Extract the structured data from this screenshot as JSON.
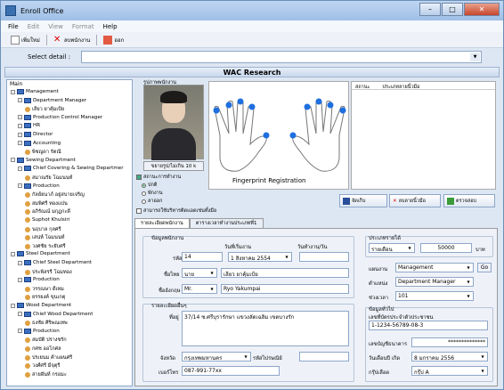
{
  "app": {
    "title": "Enroll Office"
  },
  "menu": [
    "File",
    "Edit",
    "View",
    "Format",
    "Help"
  ],
  "toolbar": {
    "new": "เพิ่มใหม่",
    "delete": "ลบพนักงาน",
    "exit": "ออก"
  },
  "select": {
    "label": "Select detail :",
    "value": ""
  },
  "header": {
    "title": "WAC Research"
  },
  "tree": {
    "title": "Main",
    "items": [
      {
        "label": "Management",
        "level": 1,
        "type": "folder"
      },
      {
        "label": "Department Manager",
        "level": 2,
        "type": "folder"
      },
      {
        "label": "เลียว ยาคุ้มเป้ย",
        "level": 3,
        "type": "person"
      },
      {
        "label": "Production Control Manager",
        "level": 2,
        "type": "folder"
      },
      {
        "label": "HR",
        "level": 2,
        "type": "folder"
      },
      {
        "label": "Director",
        "level": 2,
        "type": "folder"
      },
      {
        "label": "Accounting",
        "level": 2,
        "type": "folder"
      },
      {
        "label": "พิชญดา รัตณี",
        "level": 3,
        "type": "person"
      },
      {
        "label": "Sewing Department",
        "level": 1,
        "type": "folder"
      },
      {
        "label": "Chief Covering & Sewing Departmer",
        "level": 2,
        "type": "folder"
      },
      {
        "label": "สมาณรัย โฉมนนท์",
        "level": 3,
        "type": "person"
      },
      {
        "label": "Production",
        "level": 2,
        "type": "folder"
      },
      {
        "label": "กัลย์ยนาภ์ อยู่สบายเจริญ",
        "level": 3,
        "type": "person"
      },
      {
        "label": "สมพิศรี ทองแปน",
        "level": 3,
        "type": "person"
      },
      {
        "label": "อภิรัณณ์ มกุฏกะดี",
        "level": 3,
        "type": "person"
      },
      {
        "label": "Suphot Khulsiri",
        "level": 3,
        "type": "person"
      },
      {
        "label": "นฤบาล กุลศรี",
        "level": 3,
        "type": "person"
      },
      {
        "label": "เสน่ห์ โฉมนนท์",
        "level": 3,
        "type": "person"
      },
      {
        "label": "วงศชัย ระยับศรี",
        "level": 3,
        "type": "person"
      },
      {
        "label": "Steel Department",
        "level": 1,
        "type": "folder"
      },
      {
        "label": "Chief Steel Department",
        "level": 2,
        "type": "folder"
      },
      {
        "label": "ประพิสรรี โฉมทอง",
        "level": 3,
        "type": "person"
      },
      {
        "label": "Production",
        "level": 2,
        "type": "folder"
      },
      {
        "label": "วรรณษา ดีเหม",
        "level": 3,
        "type": "person"
      },
      {
        "label": "ยรรยงค์ ขุนเกตุ",
        "level": 3,
        "type": "person"
      },
      {
        "label": "Wood Department",
        "level": 1,
        "type": "folder"
      },
      {
        "label": "Chief Wood Department",
        "level": 2,
        "type": "folder"
      },
      {
        "label": "ธงชัย ศิริพณเทพ",
        "level": 3,
        "type": "person"
      },
      {
        "label": "Production",
        "level": 2,
        "type": "folder"
      },
      {
        "label": "สมบัติ ปรางชรัก",
        "level": 3,
        "type": "person"
      },
      {
        "label": "กศช ออโกศล",
        "level": 3,
        "type": "person"
      },
      {
        "label": "ปรเยนม ค้าแผนศรี",
        "level": 3,
        "type": "person"
      },
      {
        "label": "วงศ์ศรี มีจุตุรี",
        "level": 3,
        "type": "person"
      },
      {
        "label": "สายฝันท์ กรอมะ",
        "level": 3,
        "type": "person"
      }
    ]
  },
  "photo": {
    "label": "รูปภาพพนักงาน",
    "button": "ขยายรูป/ไม่เกิน 10 k"
  },
  "status": {
    "title": "สถานะการทำงาน",
    "options": [
      "ปกติ",
      "พักงาน",
      "ลาออก"
    ],
    "selected": 0,
    "all_work": "สามารถใช้บริหารติดแอดเช่นทั้งมือ"
  },
  "fingerprint": {
    "label": "Fingerprint Registration",
    "col1": "สถานะ",
    "col2": "ประเภทลายนิ้วมือ"
  },
  "actions": {
    "save": "จัดเก็บ",
    "delete_fp": "ลบลายนิ้วมือ",
    "verify": "ตรวจสอบ"
  },
  "tabs": [
    "รายละเอียดพนักงาน",
    "ตารางเวลาทำงานประเภทที่1"
  ],
  "form": {
    "section_employee": "ข้อมูลพนักงาน",
    "id_label": "รหัส",
    "id_value": "14",
    "start_label": "วันที่เริ่มงาน",
    "start_day": "1",
    "start_month": "สิงหาคม",
    "start_year": "2554",
    "workdays_label": "วันทำงาน/วัน",
    "thai_name_label": "ชื่อไทย",
    "thai_prefix": "นาย",
    "thai_name": "เลียว ยาคุ้มเป้ย",
    "en_name_label": "ชื่ออังกฤษ",
    "en_prefix": "Mr.",
    "en_name": "Ryo Yakumpai",
    "section_address": "รายละเอียดอื่นๆ",
    "address_label": "ที่อยู่",
    "address": "37/14 ซ.ศรีบุรารักษา แขวงลัดเฉลิม เขตบางรัก",
    "province_label": "จังหวัด",
    "province": "กรุงเทพมหานคร",
    "zip_label": "รหัสไปรษณีย์",
    "zip": "",
    "phone_label": "เบอร์โทร",
    "phone": "087-991-77xx",
    "section_wage": "ประเภทรายได้",
    "wage_type": "รายเดือน",
    "wage_value": "50000",
    "wage_unit": "บาท",
    "dept_label": "แผนงาน",
    "dept_value": "Management",
    "dept_btn": "Go",
    "position_label": "ตำแหน่ง",
    "position_value": "Department Manager",
    "shift_label": "ช่วงเวลา",
    "shift_value": "101",
    "section_general": "ข้อมูลทั่วไป",
    "idcard_label": "เลขที่บัตรประจำตัวประชาชน",
    "idcard": "1-1234-56789-08-3",
    "account_label": "เลขบัญชีธนาคาร",
    "account": "**************",
    "birth_label": "วันเดือนปี เกิด",
    "birth_day": "8",
    "birth_month": "มกราคม",
    "birth_year": "2556",
    "blood_label": "กรุ๊ปเลือด",
    "blood": "กรุ๊ป A"
  }
}
